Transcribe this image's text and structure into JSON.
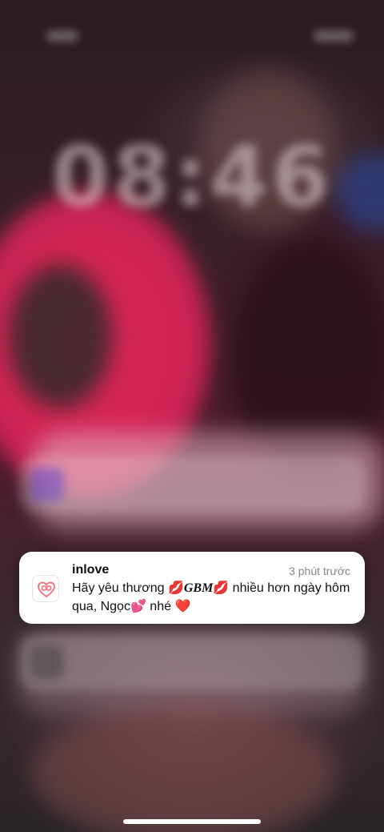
{
  "lockscreen": {
    "clock_text": "08:46"
  },
  "notification": {
    "app_name": "inlove",
    "timestamp": "3 phút trước",
    "message_parts": {
      "part1": "Hãy yêu thương ",
      "emoji1": "💋",
      "bold": "GBM",
      "emoji2": "💋",
      "part2": " nhiều hơn ngày hôm qua, Ngọc",
      "emoji3": "💕",
      "part3": " nhé ",
      "emoji4": "❤️"
    },
    "icon": "inlove-heart-icon",
    "accent_color": "#f07a8a"
  },
  "colors": {
    "notification_bg": "#ffffff",
    "timestamp_color": "#8a8a8e"
  }
}
